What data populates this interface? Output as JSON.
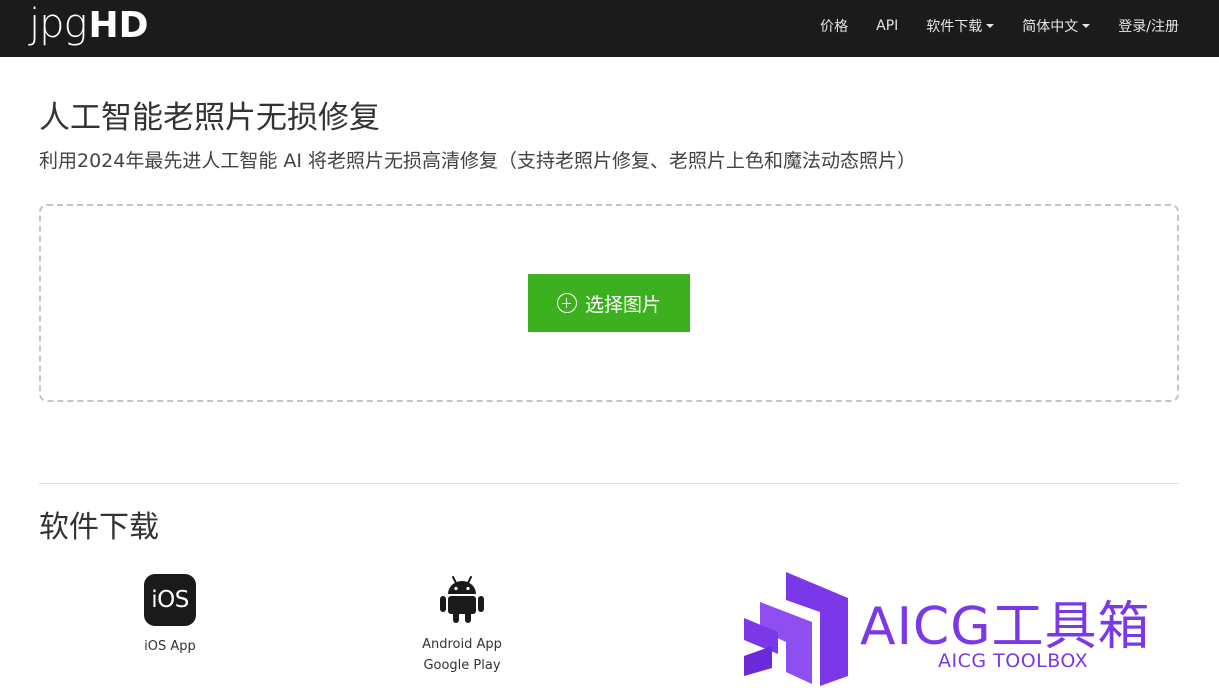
{
  "navbar": {
    "logo_light": "jpg",
    "logo_bold": "HD",
    "items": [
      {
        "label": "价格"
      },
      {
        "label": "API"
      },
      {
        "label": "软件下载",
        "dropdown": true
      },
      {
        "label": "简体中文",
        "dropdown": true
      },
      {
        "label": "登录/注册"
      }
    ]
  },
  "hero": {
    "title": "人工智能老照片无损修复",
    "subtitle": "利用2024年最先进人工智能 AI 将老照片无损高清修复（支持老照片修复、老照片上色和魔法动态照片）"
  },
  "upload": {
    "button_label": "选择图片",
    "button_color": "#3cb01e"
  },
  "downloads": {
    "title": "软件下载",
    "ios": {
      "icon_text": "iOS",
      "label": "iOS App"
    },
    "android": {
      "label_line1": "Android App",
      "label_line2": "Google Play"
    }
  },
  "watermark": {
    "title": "AICG工具箱",
    "subtitle": "AICG TOOLBOX",
    "color": "#7b38e8"
  }
}
